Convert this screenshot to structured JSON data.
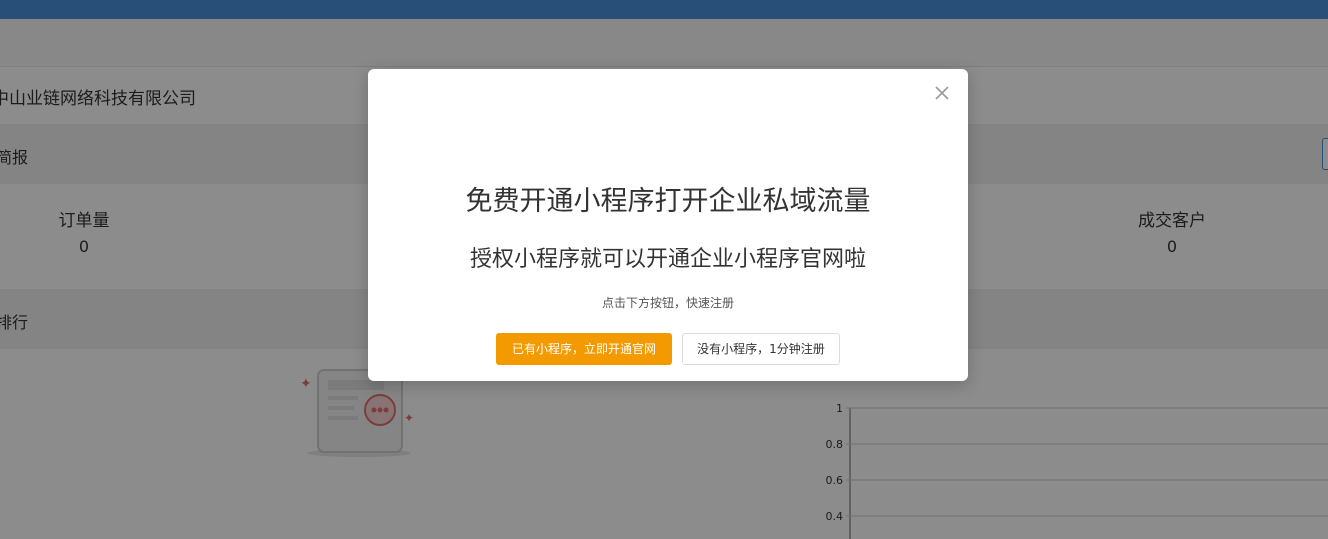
{
  "background": {
    "company_name": "中山业链网络科技有限公司",
    "section1_title": "简报",
    "section2_title": "排行",
    "stats": [
      {
        "label": "订单量",
        "value": "0"
      },
      {
        "label": "成交客户",
        "value": "0"
      }
    ]
  },
  "chart_data": {
    "type": "bar",
    "y_ticks": [
      "1",
      "0.8",
      "0.6",
      "0.4"
    ],
    "ylim": [
      0,
      1
    ],
    "grid": true
  },
  "dialog": {
    "title": "免费开通小程序打开企业私域流量",
    "subtitle": "授权小程序就可以开通企业小程序官网啦",
    "hint": "点击下方按钮，快速注册",
    "primary_button": "已有小程序，立即开通官网",
    "secondary_button": "没有小程序，1分钟注册"
  },
  "colors": {
    "accent_orange": "#f39a00",
    "brand_blue": "#4a90d9"
  }
}
